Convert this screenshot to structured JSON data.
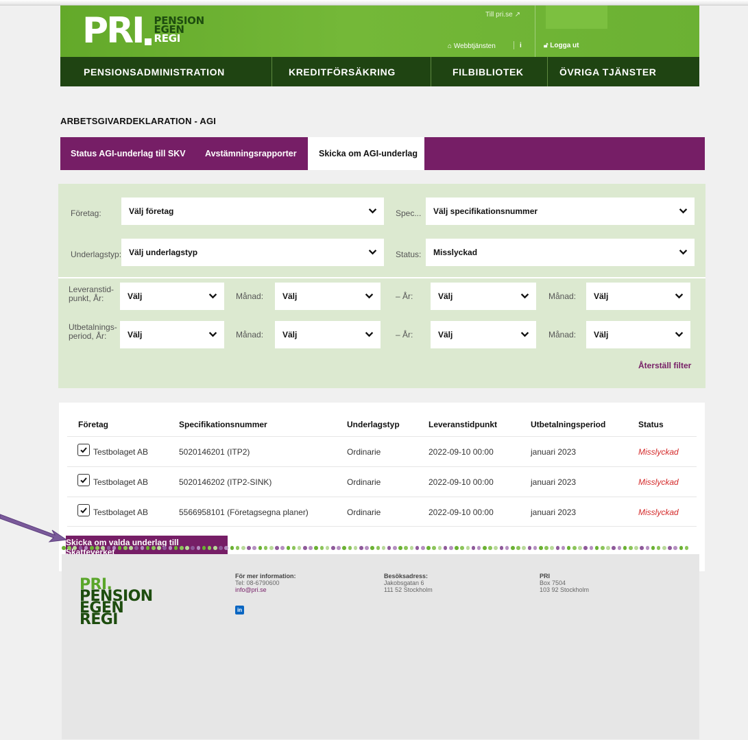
{
  "header": {
    "logo_main": "PRI",
    "logo_sub": [
      "PENSION",
      "EGEN",
      "REGI"
    ],
    "till_pri": "Till pri.se",
    "webbtjansten": "Webbtjänsten",
    "info": "i",
    "logout": "Logga ut"
  },
  "nav": [
    {
      "label": "PENSIONSADMINISTRATION"
    },
    {
      "label": "KREDITFÖRSÄKRING"
    },
    {
      "label": "FILBIBLIOTEK"
    },
    {
      "label": "ÖVRIGA TJÄNSTER"
    }
  ],
  "page_title": "ARBETSGIVARDEKLARATION - AGI",
  "tabs": [
    {
      "label": "Status AGI-underlag till SKV",
      "active": false
    },
    {
      "label": "Avstämningsrapporter",
      "active": false
    },
    {
      "label": "Skicka om AGI-underlag",
      "active": true
    }
  ],
  "filters": {
    "foretag_label": "Företag:",
    "foretag_value": "Välj företag",
    "spec_label": "Spec...",
    "spec_value": "Välj specifikationsnummer",
    "underlagstyp_label": "Underlagstyp:",
    "underlagstyp_value": "Välj underlagstyp",
    "status_label": "Status:",
    "status_value": "Misslyckad",
    "lev_label_1": "Leveranstid-",
    "lev_label_2": "punkt, År:",
    "utb_label_1": "Utbetalnings-",
    "utb_label_2": "period, År:",
    "manad_label": "Månad:",
    "ar_label": "– År:",
    "valj": "Välj",
    "reset": "Återställ filter"
  },
  "table": {
    "headers": [
      "Företag",
      "Specifikationsnummer",
      "Underlagstyp",
      "Leveranstidpunkt",
      "Utbetalningsperiod",
      "Status"
    ],
    "rows": [
      {
        "company": "Testbolaget AB",
        "spec": "5020146201 (ITP2)",
        "type": "Ordinarie",
        "delivery": "2022-09-10 00:00",
        "period": "januari 2023",
        "status": "Misslyckad",
        "checked": true
      },
      {
        "company": "Testbolaget AB",
        "spec": "5020146202 (ITP2-SINK)",
        "type": "Ordinarie",
        "delivery": "2022-09-10 00:00",
        "period": "januari 2023",
        "status": "Misslyckad",
        "checked": true
      },
      {
        "company": "Testbolaget AB",
        "spec": "5566958101 (Företagsegna planer)",
        "type": "Ordinarie",
        "delivery": "2022-09-10 00:00",
        "period": "januari 2023",
        "status": "Misslyckad",
        "checked": true
      }
    ],
    "send_button": "Skicka om valda underlag till Skatteverket"
  },
  "footer": {
    "logo": [
      "PRI.",
      "PENSION",
      "EGEN",
      "REGI"
    ],
    "info_heading": "För mer information:",
    "info_tel": "Tel: 08-6790600",
    "info_email": "info@pri.se",
    "visit_heading": "Besöksadress:",
    "visit_street": "Jakobsgatan 6",
    "visit_city": "111 52 Stockholm",
    "post_heading": "PRI",
    "post_box": "Box 7504",
    "post_city": "103 92 Stockholm",
    "linkedin": "in"
  },
  "colors": {
    "brand_green": "#6bb133",
    "nav_dark_green": "#1f4412",
    "brand_purple": "#761e66",
    "filter_bg": "#dce9d0",
    "status_error": "#d42a2a"
  }
}
